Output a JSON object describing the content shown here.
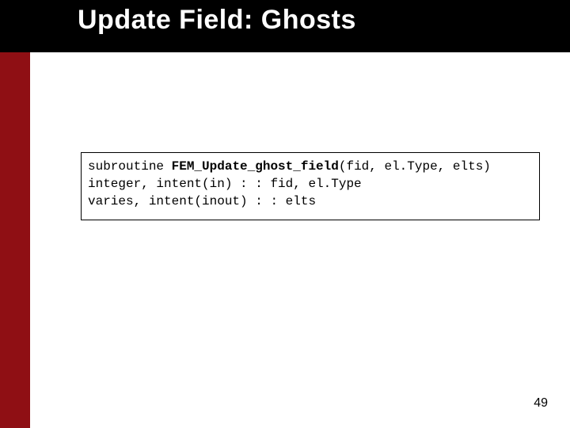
{
  "title": "Update Field: Ghosts",
  "code": {
    "line1_pre": "subroutine ",
    "line1_bold": "FEM_Update_ghost_field",
    "line1_post": "(fid, el.Type, elts)",
    "line2": "integer, intent(in) : : fid, el.Type",
    "line3": "varies, intent(inout) : : elts"
  },
  "page_number": "49"
}
